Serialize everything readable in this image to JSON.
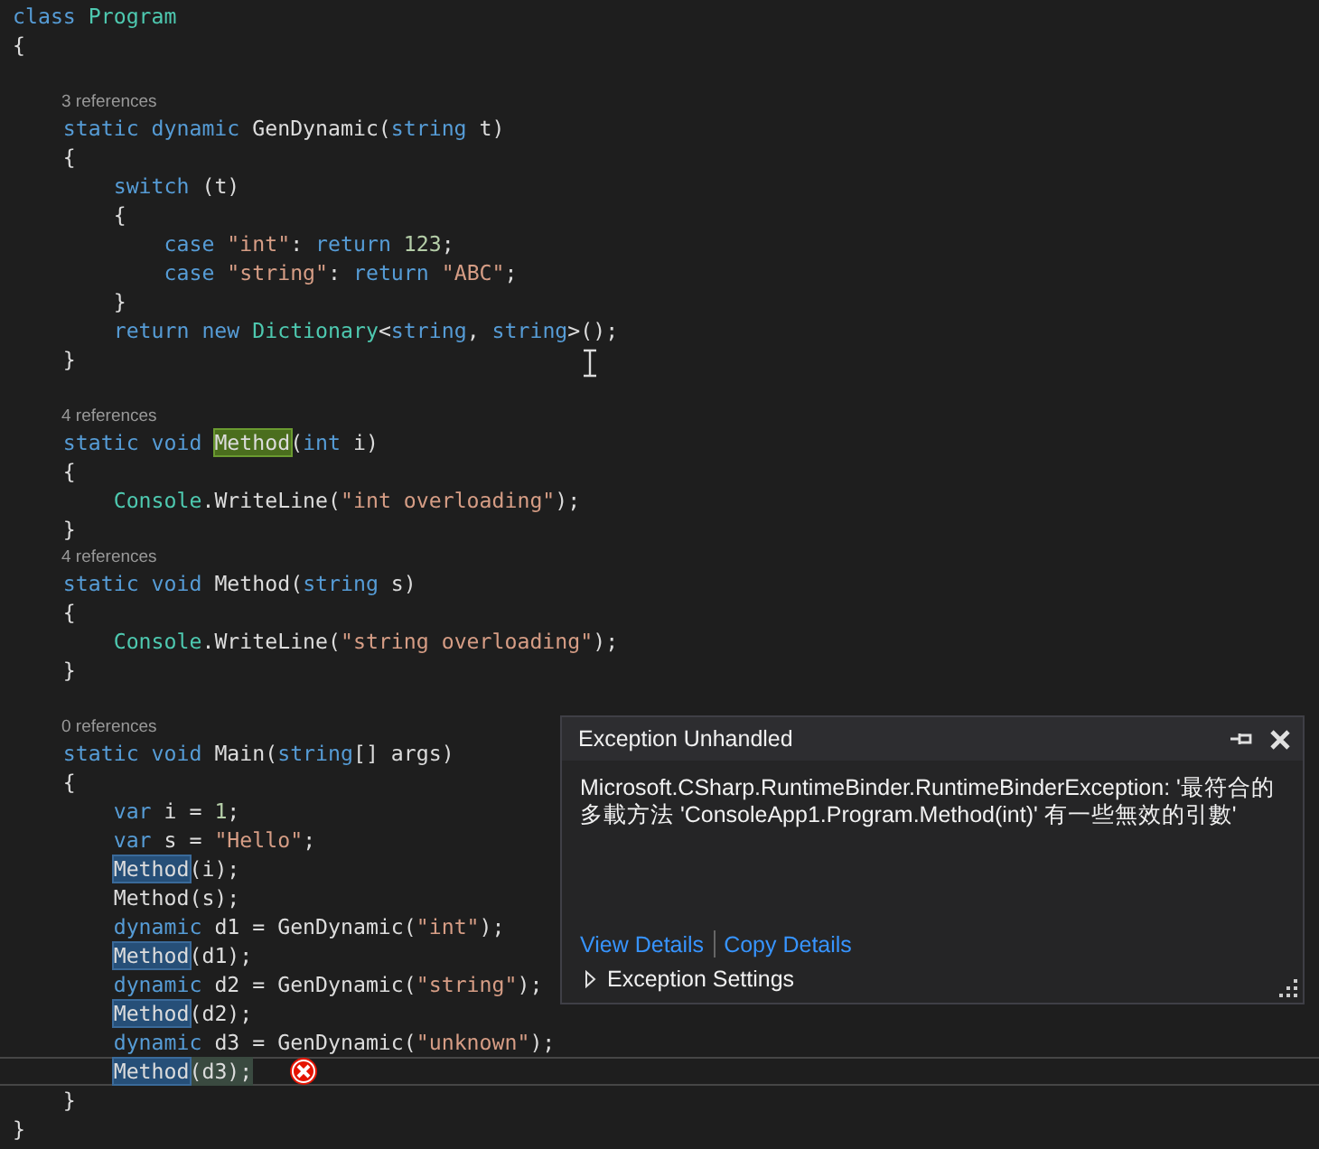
{
  "editor": {
    "lines": [
      {
        "kind": "code",
        "current": false,
        "tokens": [
          {
            "text": "class ",
            "kind": "keyword"
          },
          {
            "text": "Program",
            "kind": "type"
          }
        ]
      },
      {
        "kind": "code",
        "current": false,
        "tokens": [
          {
            "text": "{",
            "kind": "text"
          }
        ]
      },
      {
        "kind": "blank"
      },
      {
        "kind": "lens",
        "text": "3 references"
      },
      {
        "kind": "code",
        "current": false,
        "tokens": [
          {
            "text": "    static dynamic ",
            "kind": "keyword"
          },
          {
            "text": "GenDynamic(",
            "kind": "text"
          },
          {
            "text": "string",
            "kind": "keyword"
          },
          {
            "text": " t)",
            "kind": "text"
          }
        ]
      },
      {
        "kind": "code",
        "current": false,
        "tokens": [
          {
            "text": "    {",
            "kind": "text"
          }
        ]
      },
      {
        "kind": "code",
        "current": false,
        "tokens": [
          {
            "text": "        switch",
            "kind": "keyword"
          },
          {
            "text": " (t)",
            "kind": "text"
          }
        ]
      },
      {
        "kind": "code",
        "current": false,
        "tokens": [
          {
            "text": "        {",
            "kind": "text"
          }
        ]
      },
      {
        "kind": "code",
        "current": false,
        "tokens": [
          {
            "text": "            case ",
            "kind": "keyword"
          },
          {
            "text": "\"int\"",
            "kind": "string"
          },
          {
            "text": ": ",
            "kind": "text"
          },
          {
            "text": "return ",
            "kind": "keyword"
          },
          {
            "text": "123",
            "kind": "number"
          },
          {
            "text": ";",
            "kind": "text"
          }
        ]
      },
      {
        "kind": "code",
        "current": false,
        "tokens": [
          {
            "text": "            case ",
            "kind": "keyword"
          },
          {
            "text": "\"string\"",
            "kind": "string"
          },
          {
            "text": ": ",
            "kind": "text"
          },
          {
            "text": "return ",
            "kind": "keyword"
          },
          {
            "text": "\"ABC\"",
            "kind": "string"
          },
          {
            "text": ";",
            "kind": "text"
          }
        ]
      },
      {
        "kind": "code",
        "current": false,
        "tokens": [
          {
            "text": "        }",
            "kind": "text"
          }
        ]
      },
      {
        "kind": "code",
        "current": false,
        "tokens": [
          {
            "text": "        return new ",
            "kind": "keyword"
          },
          {
            "text": "Dictionary",
            "kind": "type"
          },
          {
            "text": "<",
            "kind": "text"
          },
          {
            "text": "string",
            "kind": "keyword"
          },
          {
            "text": ", ",
            "kind": "text"
          },
          {
            "text": "string",
            "kind": "keyword"
          },
          {
            "text": ">();",
            "kind": "text"
          }
        ]
      },
      {
        "kind": "code",
        "current": false,
        "tokens": [
          {
            "text": "    }",
            "kind": "text"
          }
        ]
      },
      {
        "kind": "blank"
      },
      {
        "kind": "lens",
        "text": "4 references"
      },
      {
        "kind": "code",
        "current": false,
        "tokens": [
          {
            "text": "    static void ",
            "kind": "keyword"
          },
          {
            "text": "Method",
            "kind": "definition"
          },
          {
            "text": "(",
            "kind": "text"
          },
          {
            "text": "int",
            "kind": "keyword"
          },
          {
            "text": " i)",
            "kind": "text"
          }
        ]
      },
      {
        "kind": "code",
        "current": false,
        "tokens": [
          {
            "text": "    {",
            "kind": "text"
          }
        ]
      },
      {
        "kind": "code",
        "current": false,
        "tokens": [
          {
            "text": "        Console",
            "kind": "type"
          },
          {
            "text": ".WriteLine(",
            "kind": "text"
          },
          {
            "text": "\"int overloading\"",
            "kind": "string"
          },
          {
            "text": ");",
            "kind": "text"
          }
        ]
      },
      {
        "kind": "code",
        "current": false,
        "tokens": [
          {
            "text": "    }",
            "kind": "text"
          }
        ]
      },
      {
        "kind": "lens",
        "text": "4 references"
      },
      {
        "kind": "code",
        "current": false,
        "tokens": [
          {
            "text": "    static void ",
            "kind": "keyword"
          },
          {
            "text": "Method(",
            "kind": "text"
          },
          {
            "text": "string",
            "kind": "keyword"
          },
          {
            "text": " s)",
            "kind": "text"
          }
        ]
      },
      {
        "kind": "code",
        "current": false,
        "tokens": [
          {
            "text": "    {",
            "kind": "text"
          }
        ]
      },
      {
        "kind": "code",
        "current": false,
        "tokens": [
          {
            "text": "        Console",
            "kind": "type"
          },
          {
            "text": ".WriteLine(",
            "kind": "text"
          },
          {
            "text": "\"string overloading\"",
            "kind": "string"
          },
          {
            "text": ");",
            "kind": "text"
          }
        ]
      },
      {
        "kind": "code",
        "current": false,
        "tokens": [
          {
            "text": "    }",
            "kind": "text"
          }
        ]
      },
      {
        "kind": "blank"
      },
      {
        "kind": "lens",
        "text": "0 references"
      },
      {
        "kind": "code",
        "current": false,
        "tokens": [
          {
            "text": "    static void ",
            "kind": "keyword"
          },
          {
            "text": "Main(",
            "kind": "text"
          },
          {
            "text": "string",
            "kind": "keyword"
          },
          {
            "text": "[] args)",
            "kind": "text"
          }
        ]
      },
      {
        "kind": "code",
        "current": false,
        "tokens": [
          {
            "text": "    {",
            "kind": "text"
          }
        ]
      },
      {
        "kind": "code",
        "current": false,
        "tokens": [
          {
            "text": "        var ",
            "kind": "keyword"
          },
          {
            "text": "i = ",
            "kind": "text"
          },
          {
            "text": "1",
            "kind": "number"
          },
          {
            "text": ";",
            "kind": "text"
          }
        ]
      },
      {
        "kind": "code",
        "current": false,
        "tokens": [
          {
            "text": "        var ",
            "kind": "keyword"
          },
          {
            "text": "s = ",
            "kind": "text"
          },
          {
            "text": "\"Hello\"",
            "kind": "string"
          },
          {
            "text": ";",
            "kind": "text"
          }
        ]
      },
      {
        "kind": "code",
        "current": false,
        "tokens": [
          {
            "text": "        Method",
            "kind": "reference"
          },
          {
            "text": "(i);",
            "kind": "text"
          }
        ]
      },
      {
        "kind": "code",
        "current": false,
        "tokens": [
          {
            "text": "        Method(s);",
            "kind": "text"
          }
        ]
      },
      {
        "kind": "code",
        "current": false,
        "tokens": [
          {
            "text": "        dynamic ",
            "kind": "keyword"
          },
          {
            "text": "d1 = GenDynamic(",
            "kind": "text"
          },
          {
            "text": "\"int\"",
            "kind": "string"
          },
          {
            "text": ");",
            "kind": "text"
          }
        ]
      },
      {
        "kind": "code",
        "current": false,
        "tokens": [
          {
            "text": "        Method",
            "kind": "reference"
          },
          {
            "text": "(d1);",
            "kind": "text"
          }
        ]
      },
      {
        "kind": "code",
        "current": false,
        "tokens": [
          {
            "text": "        dynamic ",
            "kind": "keyword"
          },
          {
            "text": "d2 = GenDynamic(",
            "kind": "text"
          },
          {
            "text": "\"string\"",
            "kind": "string"
          },
          {
            "text": ");",
            "kind": "text"
          }
        ]
      },
      {
        "kind": "code",
        "current": false,
        "tokens": [
          {
            "text": "        Method",
            "kind": "reference"
          },
          {
            "text": "(d2);",
            "kind": "text"
          }
        ]
      },
      {
        "kind": "code",
        "current": false,
        "tokens": [
          {
            "text": "        dynamic ",
            "kind": "keyword"
          },
          {
            "text": "d3 = GenDynamic(",
            "kind": "text"
          },
          {
            "text": "\"unknown\"",
            "kind": "string"
          },
          {
            "text": ");",
            "kind": "text"
          }
        ]
      },
      {
        "kind": "code",
        "current": true,
        "tokens": [
          {
            "text": "        Method",
            "kind": "reference"
          },
          {
            "text": "(d3);",
            "kind": "text"
          }
        ]
      },
      {
        "kind": "code",
        "current": false,
        "tokens": [
          {
            "text": "    }",
            "kind": "text"
          }
        ]
      },
      {
        "kind": "code",
        "current": false,
        "tokens": [
          {
            "text": "}",
            "kind": "text"
          }
        ]
      }
    ]
  },
  "exception_popup": {
    "title": "Exception Unhandled",
    "message": "Microsoft.CSharp.RuntimeBinder.RuntimeBinderException: '最符合的多載方法 'ConsoleApp1.Program.Method(int)' 有一些無效的引數'",
    "links": [
      "View Details",
      "Copy Details"
    ],
    "settings": {
      "label": "Exception Settings",
      "expanded": false
    }
  }
}
